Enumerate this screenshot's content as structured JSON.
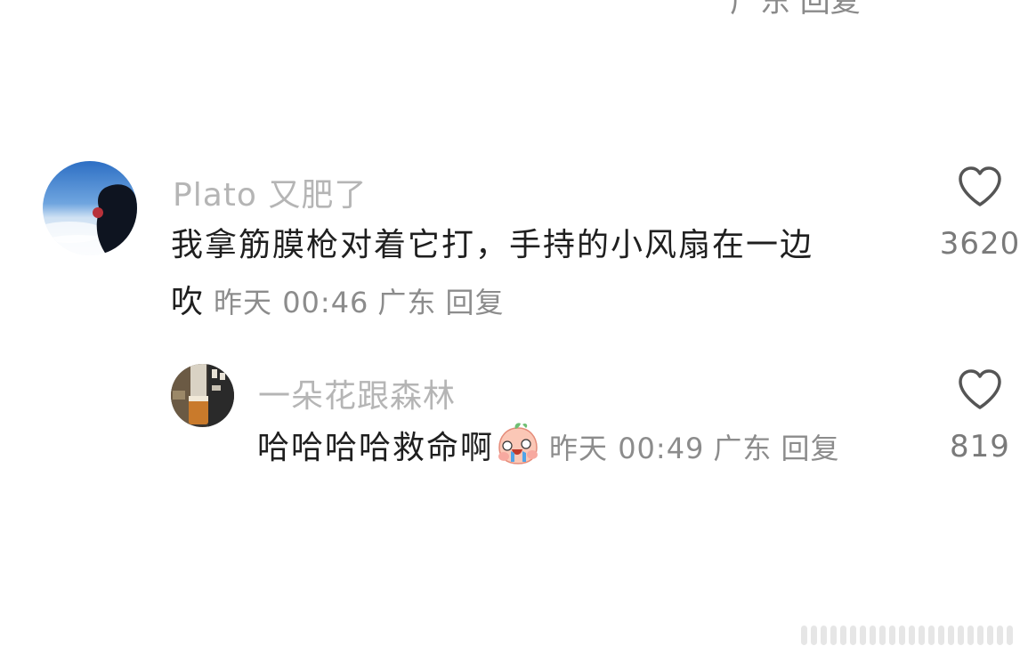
{
  "top_partial": {
    "text": "广东 回复"
  },
  "comments": [
    {
      "username": "Plato 又肥了",
      "content_line1": "我拿筋膜枪对着它打，手持的小风扇在一边",
      "content_line2": "吹",
      "time": "昨天 00:46",
      "location": "广东",
      "reply_label": "回复",
      "likes": "3620"
    },
    {
      "username": "一朵花跟森林",
      "content": "哈哈哈哈救命啊",
      "emoji": "crying-peach-emoji",
      "time": "昨天 00:49",
      "location": "广东",
      "reply_label": "回复",
      "likes": "819"
    }
  ],
  "colors": {
    "username": "#b5b5b5",
    "content": "#1f1f1f",
    "meta": "#8c8c8c",
    "heart_stroke": "#555555"
  }
}
